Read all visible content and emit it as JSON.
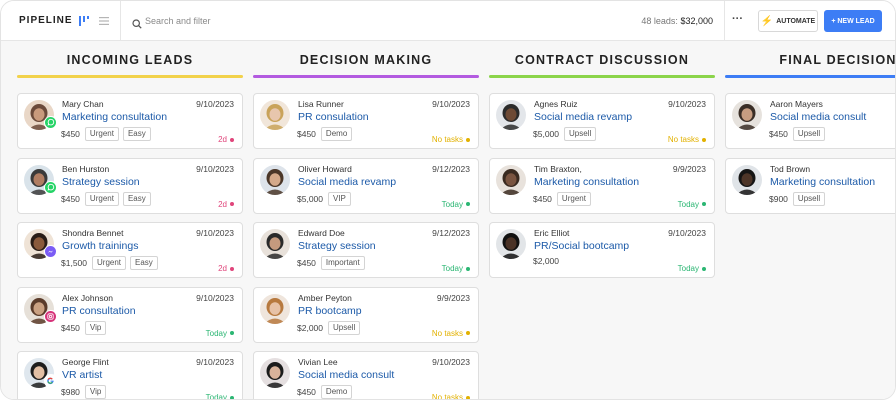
{
  "header": {
    "title": "PIPELINE",
    "search_placeholder": "Search and filter",
    "leads_count": "48 leads:",
    "leads_total": "$32,000",
    "more_label": "···",
    "automate_label": "AUTOMATE",
    "new_lead_label": "+ NEW LEAD"
  },
  "colors": {
    "incoming": "#f2d24b",
    "decision": "#b35be0",
    "contract": "#8bd44a",
    "final": "#3d7df5",
    "overdue": "#e0457b",
    "no_tasks": "#e2b100",
    "today": "#2bb673",
    "accent": "#3d7df5",
    "link": "#1c5aa8"
  },
  "columns": [
    {
      "title": "INCOMING LEADS",
      "cards": [
        {
          "name": "Mary Chan",
          "date": "9/10/2023",
          "title": "Marketing consultation",
          "amount": "$450",
          "tags": [
            "Urgent",
            "Easy"
          ],
          "due": "2d",
          "channel": "whatsapp-icon"
        },
        {
          "name": "Ben Hurston",
          "date": "9/10/2023",
          "title": "Strategy session",
          "amount": "$450",
          "tags": [
            "Urgent",
            "Easy"
          ],
          "due": "2d",
          "channel": "whatsapp-icon"
        },
        {
          "name": "Shondra Bennet",
          "date": "9/10/2023",
          "title": "Growth trainings",
          "amount": "$1,500",
          "tags": [
            "Urgent",
            "Easy"
          ],
          "due": "2d",
          "channel": "messenger-icon"
        },
        {
          "name": "Alex Johnson",
          "date": "9/10/2023",
          "title": "PR consultation",
          "amount": "$450",
          "tags": [
            "Vip"
          ],
          "due": "Today",
          "channel": "instagram-icon"
        },
        {
          "name": "George Flint",
          "date": "9/10/2023",
          "title": "VR artist",
          "amount": "$980",
          "tags": [
            "Vip"
          ],
          "due": "Today",
          "channel": "google-icon"
        }
      ]
    },
    {
      "title": "DECISION MAKING",
      "cards": [
        {
          "name": "Lisa Runner",
          "date": "9/10/2023",
          "title": "PR consulation",
          "amount": "$450",
          "tags": [
            "Demo"
          ],
          "due": "No tasks"
        },
        {
          "name": "Oliver Howard",
          "date": "9/12/2023",
          "title": "Social media revamp",
          "amount": "$5,000",
          "tags": [
            "VIP"
          ],
          "due": "Today"
        },
        {
          "name": "Edward Doe",
          "date": "9/12/2023",
          "title": "Strategy session",
          "amount": "$450",
          "tags": [
            "Important"
          ],
          "due": "Today"
        },
        {
          "name": "Amber Peyton",
          "date": "9/9/2023",
          "title": "PR bootcamp",
          "amount": "$2,000",
          "tags": [
            "Upsell"
          ],
          "due": "No tasks"
        },
        {
          "name": "Vivian Lee",
          "date": "9/10/2023",
          "title": "Social media consult",
          "amount": "$450",
          "tags": [
            "Demo"
          ],
          "due": "No tasks"
        }
      ]
    },
    {
      "title": "CONTRACT DISCUSSION",
      "cards": [
        {
          "name": "Agnes Ruiz",
          "date": "9/10/2023",
          "title": "Social media revamp",
          "amount": "$5,000",
          "tags": [
            "Upsell"
          ],
          "due": "No tasks"
        },
        {
          "name": "Tim Braxton,",
          "date": "9/9/2023",
          "title": "Marketing consultation",
          "amount": "$450",
          "tags": [
            "Urgent"
          ],
          "due": "Today"
        },
        {
          "name": "Eric Elliot",
          "date": "9/10/2023",
          "title": "PR/Social bootcamp",
          "amount": "$2,000",
          "tags": [],
          "due": "Today"
        }
      ]
    },
    {
      "title": "FINAL DECISION",
      "cards": [
        {
          "name": "Aaron Mayers",
          "date": "9/10/2023",
          "title": "Social media consult",
          "amount": "$450",
          "tags": [
            "Upsell"
          ],
          "due": ""
        },
        {
          "name": "Tod Brown",
          "date": "9/10/2023",
          "title": "Marketing consultation",
          "amount": "$900",
          "tags": [
            "Upsell"
          ],
          "due": ""
        }
      ]
    }
  ]
}
